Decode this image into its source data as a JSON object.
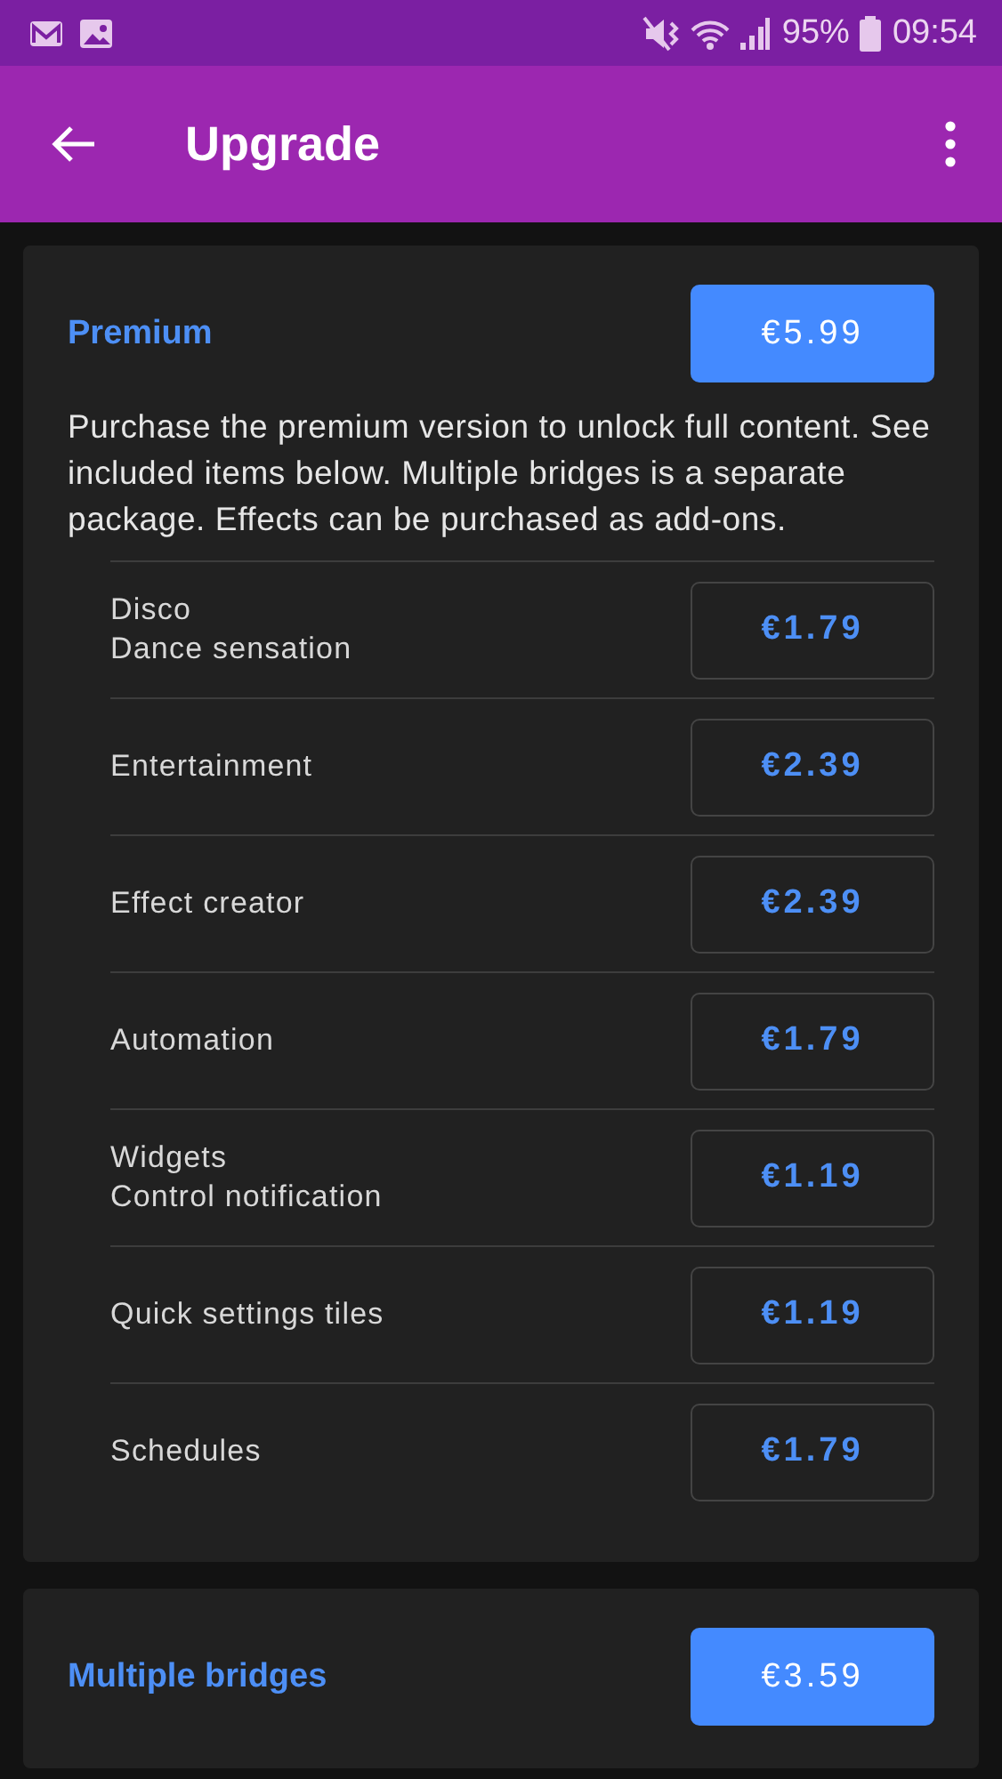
{
  "status_bar": {
    "battery": "95%",
    "time": "09:54"
  },
  "app_bar": {
    "title": "Upgrade"
  },
  "cards": [
    {
      "title": "Premium",
      "price": "€5.99",
      "description": "Purchase the premium version to unlock full content. See included items below. Multiple bridges is a separate package. Effects can be purchased as add-ons.",
      "items": [
        {
          "lines": [
            "Disco",
            "Dance sensation"
          ],
          "price": "€1.79"
        },
        {
          "lines": [
            "Entertainment"
          ],
          "price": "€2.39"
        },
        {
          "lines": [
            "Effect creator"
          ],
          "price": "€2.39"
        },
        {
          "lines": [
            "Automation"
          ],
          "price": "€1.79"
        },
        {
          "lines": [
            "Widgets",
            "Control notification"
          ],
          "price": "€1.19"
        },
        {
          "lines": [
            "Quick settings tiles"
          ],
          "price": "€1.19"
        },
        {
          "lines": [
            "Schedules"
          ],
          "price": "€1.79"
        }
      ]
    },
    {
      "title": "Multiple bridges",
      "price": "€3.59"
    }
  ]
}
